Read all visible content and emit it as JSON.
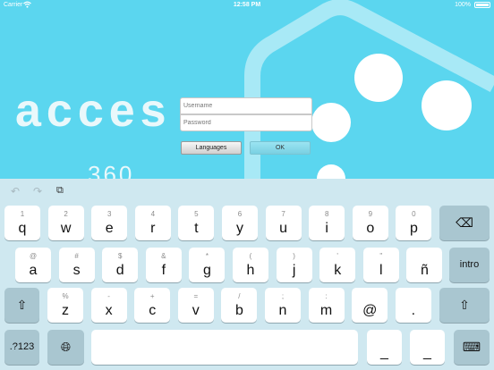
{
  "status_bar": {
    "carrier": "Carrier",
    "wifi_icon": "wifi-icon",
    "time": "12:58 PM",
    "battery_percent": "100%"
  },
  "login": {
    "logo_text": "acces",
    "logo_subtext": "360",
    "username_placeholder": "Username",
    "password_placeholder": "Password",
    "languages_label": "Languages",
    "ok_label": "OK"
  },
  "keyboard": {
    "toolbar": {
      "undo_icon": "undo-icon",
      "redo_icon": "redo-icon",
      "paste_icon": "paste-icon"
    },
    "row1": [
      {
        "hint": "1",
        "char": "q"
      },
      {
        "hint": "2",
        "char": "w"
      },
      {
        "hint": "3",
        "char": "e"
      },
      {
        "hint": "4",
        "char": "r"
      },
      {
        "hint": "5",
        "char": "t"
      },
      {
        "hint": "6",
        "char": "y"
      },
      {
        "hint": "7",
        "char": "u"
      },
      {
        "hint": "8",
        "char": "i"
      },
      {
        "hint": "9",
        "char": "o"
      },
      {
        "hint": "0",
        "char": "p"
      }
    ],
    "row2": [
      {
        "hint": "@",
        "char": "a"
      },
      {
        "hint": "#",
        "char": "s"
      },
      {
        "hint": "$",
        "char": "d"
      },
      {
        "hint": "&",
        "char": "f"
      },
      {
        "hint": "*",
        "char": "g"
      },
      {
        "hint": "(",
        "char": "h"
      },
      {
        "hint": ")",
        "char": "j"
      },
      {
        "hint": "'",
        "char": "k"
      },
      {
        "hint": "\"",
        "char": "l"
      },
      {
        "hint": "",
        "char": "ñ"
      }
    ],
    "row3": [
      {
        "hint": "%",
        "char": "z"
      },
      {
        "hint": "-",
        "char": "x"
      },
      {
        "hint": "+",
        "char": "c"
      },
      {
        "hint": "=",
        "char": "v"
      },
      {
        "hint": "/",
        "char": "b"
      },
      {
        "hint": ";",
        "char": "n"
      },
      {
        "hint": ":",
        "char": "m"
      },
      {
        "hint": "",
        "char": "@"
      },
      {
        "hint": "",
        "char": "."
      }
    ],
    "return_label": "intro",
    "numbers_label": ".?123",
    "underscore_label": "_",
    "dash_label": "_"
  }
}
